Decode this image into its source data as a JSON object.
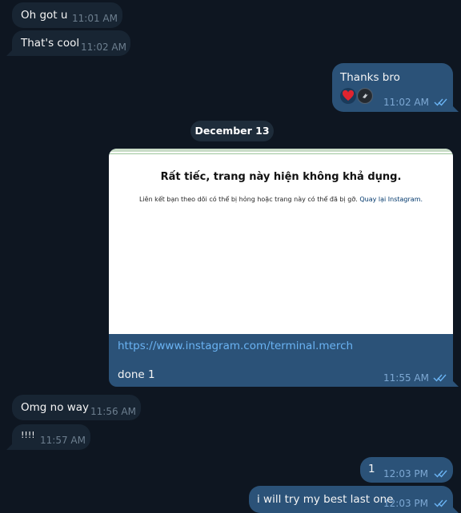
{
  "messages": [
    {
      "text": "Oh got u",
      "time": "11:01 AM"
    },
    {
      "text": "That's cool",
      "time": "11:02 AM"
    },
    {
      "text": "Thanks bro",
      "time": "11:02 AM"
    },
    {
      "date": "December 13"
    },
    {
      "preview_title": "Rất tiếc, trang này hiện không khả dụng.",
      "preview_body": "Liên kết bạn theo dõi có thể bị hỏng hoặc trang này có thể đã bị gỡ.",
      "preview_link": "Quay lại Instagram.",
      "url": "https://www.instagram.com/terminal.merch",
      "caption": "done 1",
      "time": "11:55 AM"
    },
    {
      "text": "Omg no way",
      "time": "11:56 AM"
    },
    {
      "text": "!!!!",
      "time": "11:57 AM"
    },
    {
      "text": "1",
      "time": "12:03 PM"
    },
    {
      "text": "i will try my best last one",
      "time": "12:03 PM"
    }
  ],
  "colors": {
    "background": "#0e1621",
    "incoming": "#182533",
    "outgoing": "#2b5278",
    "link": "#6ab3f3",
    "check": "#6ab3f3"
  },
  "icons": {
    "read_receipt": "double-check-icon",
    "reaction_1": "red-heart",
    "reaction_2": "user-avatar"
  }
}
